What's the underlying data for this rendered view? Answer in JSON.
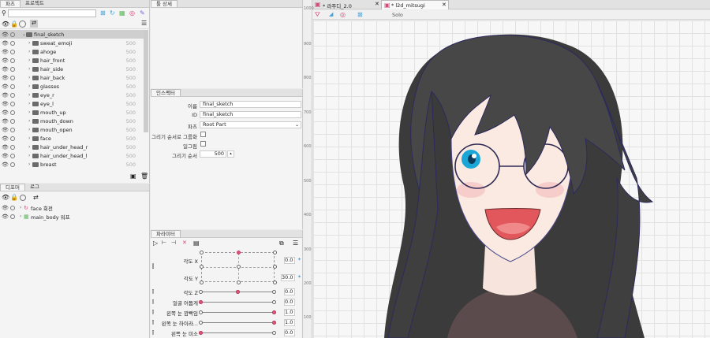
{
  "parts_panel": {
    "tabs": [
      "파츠",
      "프로젝트"
    ],
    "search_placeholder": "",
    "rows": [
      {
        "label": "final_sketch",
        "value": "",
        "level": 0,
        "selected": true
      },
      {
        "label": "sweat_emoji",
        "value": "500",
        "level": 1
      },
      {
        "label": "ahoge",
        "value": "500",
        "level": 1
      },
      {
        "label": "hair_front",
        "value": "500",
        "level": 1
      },
      {
        "label": "hair_side",
        "value": "500",
        "level": 1
      },
      {
        "label": "hair_back",
        "value": "500",
        "level": 1
      },
      {
        "label": "glasses",
        "value": "500",
        "level": 1
      },
      {
        "label": "eye_r",
        "value": "500",
        "level": 1
      },
      {
        "label": "eye_l",
        "value": "500",
        "level": 1
      },
      {
        "label": "mouth_up",
        "value": "500",
        "level": 1
      },
      {
        "label": "mouth_down",
        "value": "500",
        "level": 1
      },
      {
        "label": "mouth_open",
        "value": "500",
        "level": 1
      },
      {
        "label": "face",
        "value": "500",
        "level": 1
      },
      {
        "label": "hair_under_head_r",
        "value": "500",
        "level": 1
      },
      {
        "label": "hair_under_head_l",
        "value": "500",
        "level": 1
      },
      {
        "label": "breast",
        "value": "500",
        "level": 1
      }
    ]
  },
  "deformer_panel": {
    "tabs": [
      "디포머",
      "로그"
    ],
    "rows": [
      {
        "label": "face 회전"
      },
      {
        "label": "main_body 워프"
      }
    ]
  },
  "detail_panel": {
    "tab": "툴 상세"
  },
  "inspector": {
    "tab": "인스펙터",
    "name_label": "이름",
    "name_value": "final_sketch",
    "id_label": "ID",
    "id_value": "final_sketch",
    "parts_label": "파츠",
    "parts_value": "Root Part",
    "group_label": "그리기 순서로 그룹화",
    "clip_label": "일그림",
    "order_label": "그리기 순서",
    "order_value": "500"
  },
  "parameters": {
    "tab": "파라미터",
    "items": [
      {
        "label": "각도 X",
        "value": "0.0",
        "fraction": 0.5
      },
      {
        "label": "각도 Y",
        "value": "30.0",
        "fraction": 1.0
      },
      {
        "label": "각도 Z",
        "value": "0.0",
        "fraction": 0.5
      },
      {
        "label": "얼굴 어둡게",
        "value": "0.0",
        "fraction": 0.0
      },
      {
        "label": "왼쪽 눈 깜빡임",
        "value": "1.0",
        "fraction": 1.0
      },
      {
        "label": "왼쪽 눈 하이라...",
        "value": "1.0",
        "fraction": 1.0
      },
      {
        "label": "왼쪽 눈 미소",
        "value": "0.0",
        "fraction": 0.0
      }
    ]
  },
  "editor": {
    "tabs": [
      {
        "label": "* 라푸디_2.0",
        "active": false
      },
      {
        "label": "* l2d_mitsugi",
        "active": true
      }
    ],
    "solo_label": "Solo",
    "ruler": [
      "1000",
      "900",
      "800",
      "700",
      "600",
      "500",
      "400",
      "300",
      "200",
      "100"
    ]
  },
  "colors": {
    "accent": "#e0557a",
    "panel": "#f4f4f4",
    "canvas": "#f7f7f7"
  }
}
